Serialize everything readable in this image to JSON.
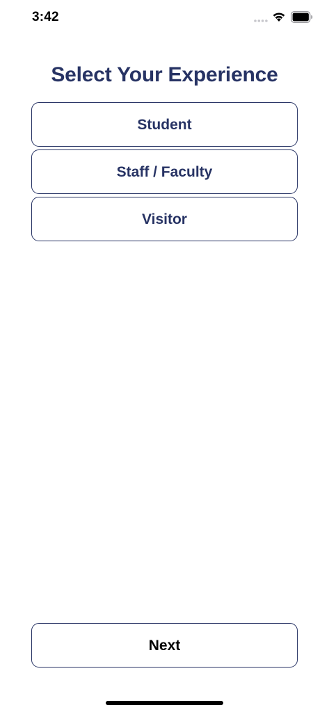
{
  "status_bar": {
    "time": "3:42",
    "icons": [
      "signal-dots-icon",
      "wifi-icon",
      "battery-icon"
    ]
  },
  "page": {
    "title": "Select Your Experience"
  },
  "options": [
    {
      "label": "Student"
    },
    {
      "label": "Staff / Faculty"
    },
    {
      "label": "Visitor"
    }
  ],
  "footer": {
    "next_label": "Next"
  },
  "colors": {
    "accent": "#273364",
    "background": "#ffffff",
    "next_text": "#000000"
  }
}
